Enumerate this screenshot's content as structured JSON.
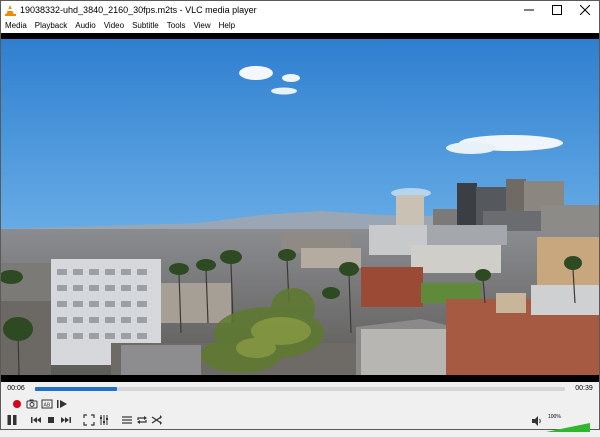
{
  "window": {
    "title": "19038332-uhd_3840_2160_30fps.m2ts - VLC media player",
    "minimize_label": "minimize",
    "maximize_label": "maximize",
    "close_label": "close"
  },
  "menu": {
    "items": [
      "Media",
      "Playback",
      "Audio",
      "Video",
      "Subtitle",
      "Tools",
      "View",
      "Help"
    ]
  },
  "playback": {
    "elapsed": "00:06",
    "total": "00:39",
    "progress_fraction": 0.155
  },
  "volume": {
    "label": "100%",
    "level_fraction": 1.0
  },
  "icons": {
    "app": "vlc-cone-icon",
    "record": "record-icon",
    "snapshot": "camera-icon",
    "loop_ab": "loop-ab-icon",
    "frame_step": "frame-step-icon",
    "play_pause": "pause-icon",
    "previous": "previous-icon",
    "stop": "stop-icon",
    "next": "next-icon",
    "fullscreen": "fullscreen-icon",
    "extended": "extended-settings-icon",
    "playlist": "playlist-icon",
    "loop": "loop-icon",
    "shuffle": "shuffle-icon",
    "speaker": "speaker-icon"
  },
  "colors": {
    "accent": "#1e6fd0",
    "record": "#d9001b",
    "volume": "#2fb82f",
    "vlc_orange": "#f28a00"
  }
}
